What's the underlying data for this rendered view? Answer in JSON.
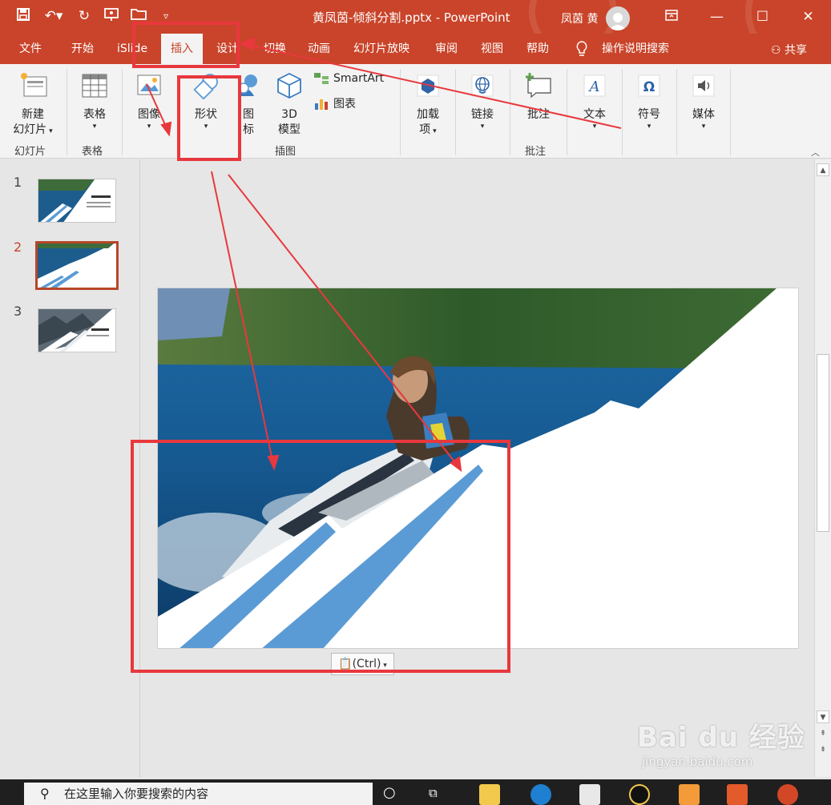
{
  "window": {
    "doc_title": "黄凤茵-倾斜分割.pptx  -  PowerPoint",
    "user_name": "凤茵 黄"
  },
  "tabs": [
    {
      "label": "文件"
    },
    {
      "label": "开始"
    },
    {
      "label": "iSlide"
    },
    {
      "label": "插入",
      "active": true
    },
    {
      "label": "设计"
    },
    {
      "label": "切换"
    },
    {
      "label": "动画"
    },
    {
      "label": "幻灯片放映"
    },
    {
      "label": "审阅"
    },
    {
      "label": "视图"
    },
    {
      "label": "帮助"
    }
  ],
  "tell_me": "操作说明搜索",
  "share_label": "共享",
  "ribbon": {
    "new_slide": {
      "line1": "新建",
      "line2": "幻灯片"
    },
    "table": "表格",
    "image": "图像",
    "shapes": "形状",
    "icons": {
      "line1": "图",
      "line2": "标"
    },
    "model3d": {
      "line1": "3D",
      "line2": "模型"
    },
    "smartart": "SmartArt",
    "chart": "图表",
    "addins": {
      "line1": "加载",
      "line2": "项"
    },
    "link": "链接",
    "comment": "批注",
    "text": "文本",
    "symbols": "符号",
    "media": "媒体",
    "groups": {
      "slides": "幻灯片",
      "tables": "表格",
      "illustrations": "插图",
      "comments": "批注"
    }
  },
  "thumbnails": [
    {
      "number": "1"
    },
    {
      "number": "2",
      "selected": true
    },
    {
      "number": "3"
    }
  ],
  "paste_options": "(Ctrl)",
  "taskbar": {
    "search_placeholder": "在这里输入你要搜索的内容"
  },
  "watermark": {
    "main": "Bai du 经验",
    "sub": "jingyan.baidu.com"
  },
  "colors": {
    "accent": "#c9442a",
    "annotation": "#e8383d",
    "slide_blue": "#5b9bd5"
  }
}
